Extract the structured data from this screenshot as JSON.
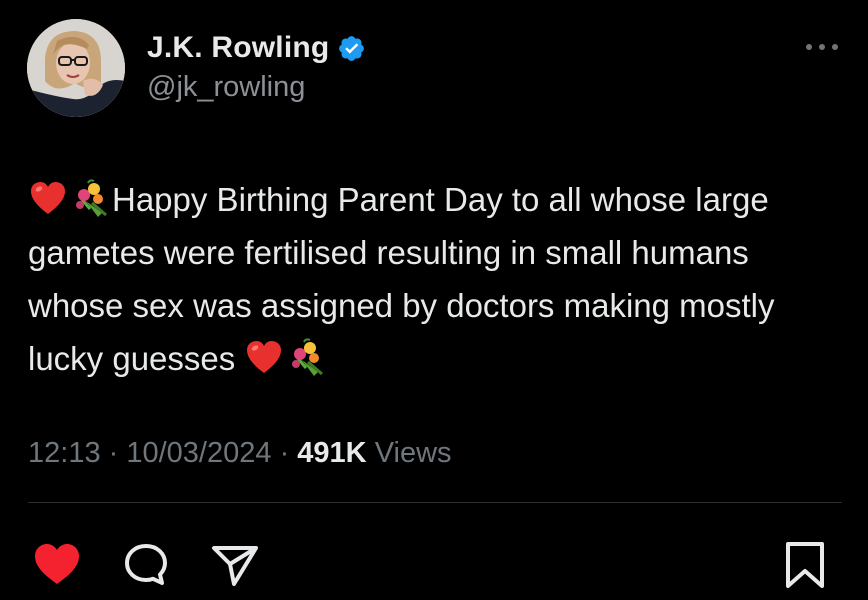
{
  "author": {
    "display_name": "J.K. Rowling",
    "handle": "@jk_rowling",
    "verified": true,
    "verified_color": "#1d9bf0"
  },
  "tweet": {
    "lead_emojis": [
      "red-heart-emoji",
      "bouquet-emoji"
    ],
    "text": "Happy Birthing Parent Day to all whose large gametes were fertilised resulting in small humans whose sex was assigned by doctors making mostly lucky guesses",
    "trail_emojis": [
      "red-heart-emoji",
      "bouquet-emoji"
    ]
  },
  "meta": {
    "time": "12:13",
    "separator": " · ",
    "date": "10/03/2024",
    "views_count": "491K",
    "views_label": "Views"
  },
  "actions": {
    "like": {
      "icon": "heart-filled-icon",
      "color": "#f91880",
      "active": true
    },
    "reply": {
      "icon": "speech-bubble-icon"
    },
    "share": {
      "icon": "paper-plane-icon"
    },
    "bookmark": {
      "icon": "bookmark-icon"
    }
  },
  "colors": {
    "background": "#000000",
    "text_primary": "#e7e9ea",
    "text_secondary": "#6f767c"
  }
}
